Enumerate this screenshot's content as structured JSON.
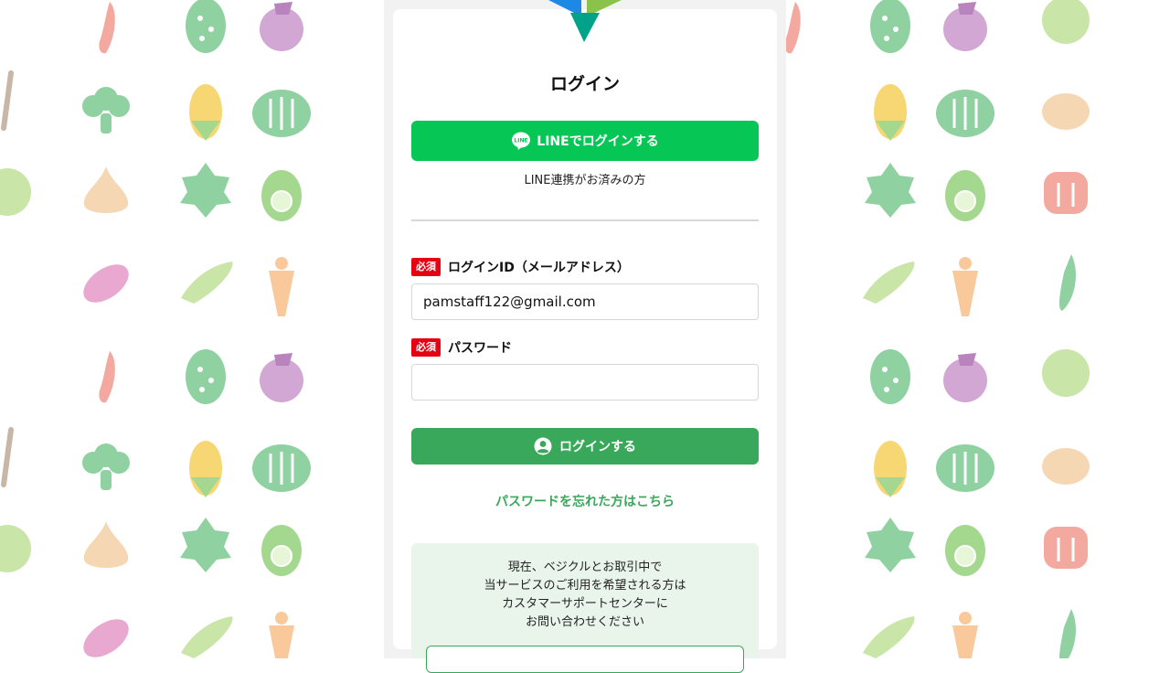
{
  "colors": {
    "line_green": "#06c755",
    "brand_green": "#3aa85a",
    "required_red": "#e50012",
    "info_bg": "#e9f5ea",
    "logo_blue": "#1e88e5",
    "logo_lime": "#8bc34a",
    "logo_teal": "#00a28a"
  },
  "logo": {
    "icon": "brand-logo-icon"
  },
  "login": {
    "title": "ログイン",
    "line_button": {
      "label": "LINEでログインする",
      "icon": "line-icon",
      "icon_text": "LINE"
    },
    "line_note": "LINE連携がお済みの方",
    "fields": {
      "login_id": {
        "badge": "必須",
        "label": "ログインID（メールアドレス）",
        "value": "pamstaff122@gmail.com"
      },
      "password": {
        "badge": "必須",
        "label": "パスワード",
        "value": ""
      }
    },
    "submit_button": {
      "label": "ログインする",
      "icon": "user-circle-icon"
    },
    "forgot_link": "パスワードを忘れた方はこちら"
  },
  "info": {
    "lines": [
      "現在、ベジクルとお取引中で",
      "当サービスのご利用を希望される方は",
      "カスタマーサポートセンターに",
      "お問い合わせください"
    ]
  },
  "background": {
    "pattern": "vegetable-illustrations"
  }
}
